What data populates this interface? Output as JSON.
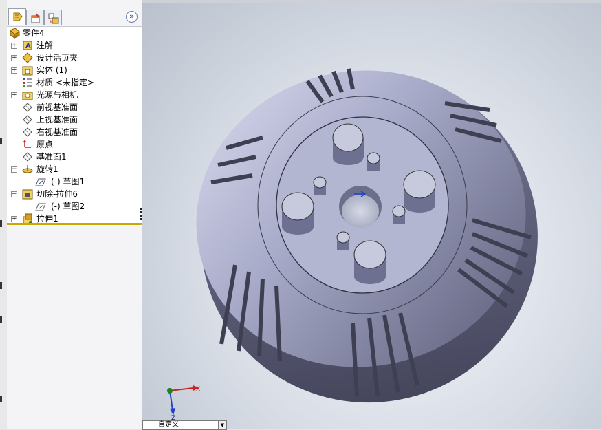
{
  "feature_tree": {
    "tabs": [
      {
        "name": "featuremanager-tab-icon"
      },
      {
        "name": "propertymanager-tab-icon"
      },
      {
        "name": "configurationmanager-tab-icon"
      }
    ],
    "expand_symbol": "»",
    "root": {
      "label": "零件4"
    },
    "items": [
      {
        "label": "注解",
        "icon": "annotations-icon",
        "expander": "+"
      },
      {
        "label": "设计活页夹",
        "icon": "design-binder-icon",
        "expander": "+"
      },
      {
        "label": "实体 (1)",
        "icon": "solid-bodies-icon",
        "expander": "+"
      },
      {
        "label": "材质 <未指定>",
        "icon": "material-icon",
        "expander": ""
      },
      {
        "label": "光源与相机",
        "icon": "lights-cameras-icon",
        "expander": "+"
      },
      {
        "label": "前视基准面",
        "icon": "plane-icon",
        "expander": ""
      },
      {
        "label": "上视基准面",
        "icon": "plane-icon",
        "expander": ""
      },
      {
        "label": "右视基准面",
        "icon": "plane-icon",
        "expander": ""
      },
      {
        "label": "原点",
        "icon": "origin-icon",
        "expander": ""
      },
      {
        "label": "基准面1",
        "icon": "plane-icon",
        "expander": ""
      },
      {
        "label": "旋转1",
        "icon": "revolve-icon",
        "expander": "−"
      },
      {
        "label": "(-) 草图1",
        "icon": "sketch-icon",
        "expander": ""
      },
      {
        "label": "切除-拉伸6",
        "icon": "cut-extrude-icon",
        "expander": "−"
      },
      {
        "label": "(-) 草图2",
        "icon": "sketch-icon",
        "expander": ""
      },
      {
        "label": "拉伸1",
        "icon": "boss-extrude-icon",
        "expander": "+"
      }
    ]
  },
  "viewport": {
    "triad": {
      "x_label": "X",
      "z_label": "Z"
    },
    "view_combo": "自定义"
  },
  "colors": {
    "model_face": "#a4a7c6",
    "model_shade": "#5d5f7a",
    "tree_terminator": "#c9a800"
  }
}
